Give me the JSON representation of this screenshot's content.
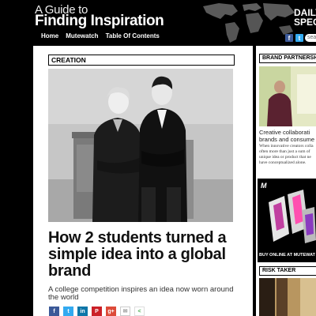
{
  "site": {
    "kicker": "A Guide to",
    "title": "Finding Inspiration",
    "partner_line1": "DAILY",
    "partner_line2": "SPECI"
  },
  "nav": {
    "items": [
      "Home",
      "Mutewatch",
      "Table Of Contents"
    ]
  },
  "top_social": {
    "facebook_glyph": "f",
    "twitter_glyph": "t",
    "search_placeholder": "searc"
  },
  "article": {
    "section": "CREATION",
    "headline": "How 2 students turned a simple idea into a global brand",
    "subhead": "A college competition inspires an idea now worn around the world",
    "share_buttons": [
      {
        "name": "facebook",
        "glyph": "f",
        "color": "#3b5998"
      },
      {
        "name": "twitter",
        "glyph": "t",
        "color": "#33aaf0"
      },
      {
        "name": "linkedin",
        "glyph": "in",
        "color": "#0e76a8"
      },
      {
        "name": "pinterest",
        "glyph": "P",
        "color": "#cb2027"
      },
      {
        "name": "google-plus",
        "glyph": "g+",
        "color": "#dd4b39"
      },
      {
        "name": "email",
        "glyph": "✉",
        "color": "#999999"
      },
      {
        "name": "share",
        "glyph": "<",
        "color": "#4caf50"
      }
    ]
  },
  "sidebar": {
    "brand_partnership": "BRAND PARTNERSH",
    "caption_line1": "Creative collaborati",
    "caption_line2": "brands and consume",
    "body_line1": "When innovative creators colla",
    "body_line2": "often more than just a sum of",
    "body_line3": "unique idea or product that ne",
    "body_line4": "have conceptualized alone.",
    "ad_logo": "M",
    "ad_cta": "BUY ONLINE AT MUTEWAT",
    "risk_taker": "RISK TAKER"
  }
}
